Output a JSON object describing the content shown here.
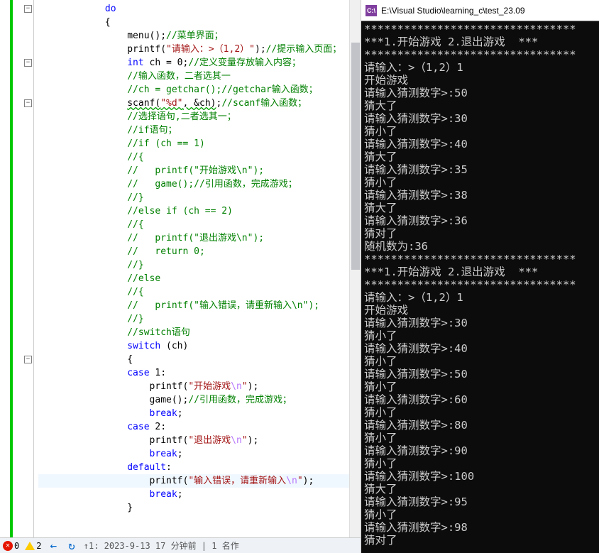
{
  "editor": {
    "lines": [
      {
        "num": "",
        "indent": 3,
        "tokens": [
          {
            "t": "do",
            "c": "kw"
          }
        ]
      },
      {
        "num": "",
        "indent": 3,
        "tokens": [
          {
            "t": "{"
          }
        ]
      },
      {
        "num": "",
        "indent": 4,
        "tokens": [
          {
            "t": "menu();"
          },
          {
            "t": "//菜单界面；",
            "c": "cmt"
          }
        ]
      },
      {
        "num": "",
        "indent": 4,
        "tokens": [
          {
            "t": "printf("
          },
          {
            "t": "\"请输入：>（1,2）\"",
            "c": "str"
          },
          {
            "t": ");"
          },
          {
            "t": "//提示输入页面；",
            "c": "cmt"
          }
        ]
      },
      {
        "num": "",
        "indent": 4,
        "tokens": [
          {
            "t": "int ",
            "c": "kw"
          },
          {
            "t": "ch = 0;"
          },
          {
            "t": "//定义变量存放输入内容；",
            "c": "cmt"
          }
        ]
      },
      {
        "num": "",
        "indent": 4,
        "tokens": [
          {
            "t": "//输入函数，二者选其一",
            "c": "cmt"
          }
        ]
      },
      {
        "num": "",
        "indent": 4,
        "tokens": [
          {
            "t": "//ch = getchar();//getchar输入函数；",
            "c": "cmt"
          }
        ]
      },
      {
        "num": "",
        "indent": 4,
        "tokens": [
          {
            "t": "scanf(",
            "c": "err-und"
          },
          {
            "t": "\"%d\"",
            "c": "str err-und"
          },
          {
            "t": ", &ch)",
            "c": "err-und"
          },
          {
            "t": ";"
          },
          {
            "t": "//scanf输入函数；",
            "c": "cmt"
          }
        ]
      },
      {
        "num": "",
        "indent": 4,
        "tokens": [
          {
            "t": "//选择语句,二者选其一；",
            "c": "cmt"
          }
        ]
      },
      {
        "num": "",
        "indent": 4,
        "tokens": [
          {
            "t": "//if语句；",
            "c": "cmt"
          }
        ]
      },
      {
        "num": "",
        "indent": 4,
        "tokens": [
          {
            "t": "//if (ch == 1)",
            "c": "cmt"
          }
        ]
      },
      {
        "num": "",
        "indent": 4,
        "tokens": [
          {
            "t": "//{",
            "c": "cmt"
          }
        ]
      },
      {
        "num": "",
        "indent": 4,
        "tokens": [
          {
            "t": "//   printf(\"开始游戏\\n\");",
            "c": "cmt"
          }
        ]
      },
      {
        "num": "",
        "indent": 4,
        "tokens": [
          {
            "t": "//   game();//引用函数，完成游戏；",
            "c": "cmt"
          }
        ]
      },
      {
        "num": "",
        "indent": 4,
        "tokens": [
          {
            "t": "//}",
            "c": "cmt"
          }
        ]
      },
      {
        "num": "",
        "indent": 4,
        "tokens": [
          {
            "t": "//else if (ch == 2)",
            "c": "cmt"
          }
        ]
      },
      {
        "num": "",
        "indent": 4,
        "tokens": [
          {
            "t": "//{",
            "c": "cmt"
          }
        ]
      },
      {
        "num": "",
        "indent": 4,
        "tokens": [
          {
            "t": "//   printf(\"退出游戏\\n\");",
            "c": "cmt"
          }
        ]
      },
      {
        "num": "",
        "indent": 4,
        "tokens": [
          {
            "t": "//   return 0;",
            "c": "cmt"
          }
        ]
      },
      {
        "num": "",
        "indent": 4,
        "tokens": [
          {
            "t": "//}",
            "c": "cmt"
          }
        ]
      },
      {
        "num": "",
        "indent": 4,
        "tokens": [
          {
            "t": "//else",
            "c": "cmt"
          }
        ]
      },
      {
        "num": "",
        "indent": 4,
        "tokens": [
          {
            "t": "//{",
            "c": "cmt"
          }
        ]
      },
      {
        "num": "",
        "indent": 4,
        "tokens": [
          {
            "t": "//   printf(\"输入错误，请重新输入\\n\");",
            "c": "cmt"
          }
        ]
      },
      {
        "num": "",
        "indent": 4,
        "tokens": [
          {
            "t": "//}",
            "c": "cmt"
          }
        ]
      },
      {
        "num": "",
        "indent": 4,
        "tokens": [
          {
            "t": "//switch语句",
            "c": "cmt"
          }
        ]
      },
      {
        "num": "",
        "indent": 4,
        "tokens": [
          {
            "t": "switch ",
            "c": "kw"
          },
          {
            "t": "(ch)"
          }
        ]
      },
      {
        "num": "",
        "indent": 4,
        "tokens": [
          {
            "t": "{"
          }
        ]
      },
      {
        "num": "",
        "indent": 4,
        "tokens": [
          {
            "t": "case ",
            "c": "kw"
          },
          {
            "t": "1:"
          }
        ]
      },
      {
        "num": "",
        "indent": 5,
        "tokens": [
          {
            "t": "printf("
          },
          {
            "t": "\"开始游戏",
            "c": "str"
          },
          {
            "t": "\\n",
            "c": "esc"
          },
          {
            "t": "\"",
            "c": "str"
          },
          {
            "t": ");"
          }
        ]
      },
      {
        "num": "",
        "indent": 5,
        "tokens": [
          {
            "t": "game();"
          },
          {
            "t": "//引用函数，完成游戏；",
            "c": "cmt"
          }
        ]
      },
      {
        "num": "",
        "indent": 5,
        "tokens": [
          {
            "t": "break",
            "c": "kw"
          },
          {
            "t": ";"
          }
        ]
      },
      {
        "num": "",
        "indent": 4,
        "tokens": [
          {
            "t": "case ",
            "c": "kw"
          },
          {
            "t": "2:"
          }
        ]
      },
      {
        "num": "",
        "indent": 5,
        "tokens": [
          {
            "t": "printf("
          },
          {
            "t": "\"退出游戏",
            "c": "str"
          },
          {
            "t": "\\n",
            "c": "esc"
          },
          {
            "t": "\"",
            "c": "str"
          },
          {
            "t": ");"
          }
        ]
      },
      {
        "num": "",
        "indent": 5,
        "tokens": [
          {
            "t": "break",
            "c": "kw"
          },
          {
            "t": ";"
          }
        ]
      },
      {
        "num": "",
        "indent": 4,
        "tokens": [
          {
            "t": "default",
            "c": "kw"
          },
          {
            "t": ":"
          }
        ]
      },
      {
        "num": "",
        "indent": 5,
        "tokens": [
          {
            "t": "printf("
          },
          {
            "t": "\"输入错误，请重新输入",
            "c": "str"
          },
          {
            "t": "\\n",
            "c": "esc"
          },
          {
            "t": "\"",
            "c": "str"
          },
          {
            "t": ");"
          }
        ],
        "hl": true
      },
      {
        "num": "",
        "indent": 5,
        "tokens": [
          {
            "t": "break",
            "c": "kw"
          },
          {
            "t": ";"
          }
        ]
      },
      {
        "num": "",
        "indent": 4,
        "tokens": [
          {
            "t": "}"
          }
        ]
      }
    ],
    "folds": [
      {
        "line": 0,
        "type": "-"
      },
      {
        "line": 4,
        "type": "-"
      },
      {
        "line": 7,
        "type": "-"
      },
      {
        "line": 26,
        "type": "-"
      }
    ]
  },
  "status": {
    "errors": "0",
    "warnings": "2",
    "info": "↑1: 2023-9-13   17 分钟前 | 1 名作"
  },
  "console": {
    "title": "E:\\Visual Studio\\learning_c\\test_23.09",
    "lines": [
      "********************************",
      "***1.开始游戏 2.退出游戏  ***",
      "********************************",
      "请输入：>（1,2）1",
      "开始游戏",
      "请输入猜测数字>:50",
      "猜大了",
      "请输入猜测数字>:30",
      "猜小了",
      "请输入猜测数字>:40",
      "猜大了",
      "请输入猜测数字>:35",
      "猜小了",
      "请输入猜测数字>:38",
      "猜大了",
      "请输入猜测数字>:36",
      "猜对了",
      "随机数为:36",
      "********************************",
      "***1.开始游戏 2.退出游戏  ***",
      "********************************",
      "请输入：>（1,2）1",
      "开始游戏",
      "请输入猜测数字>:30",
      "猜小了",
      "请输入猜测数字>:40",
      "猜小了",
      "请输入猜测数字>:50",
      "猜小了",
      "请输入猜测数字>:60",
      "猜小了",
      "请输入猜测数字>:80",
      "猜小了",
      "请输入猜测数字>:90",
      "猜小了",
      "请输入猜测数字>:100",
      "猜大了",
      "请输入猜测数字>:95",
      "猜小了",
      "请输入猜测数字>:98",
      "猜对了"
    ]
  }
}
